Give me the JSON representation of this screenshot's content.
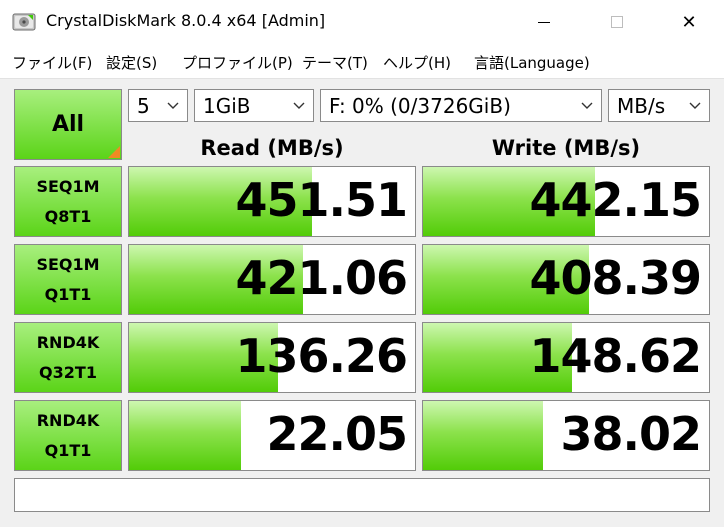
{
  "window": {
    "title": "CrystalDiskMark 8.0.4 x64 [Admin]",
    "close_glyph": "✕"
  },
  "menu": {
    "items": [
      "ファイル(F)",
      "設定(S)",
      "プロファイル(P)",
      "テーマ(T)",
      "ヘルプ(H)",
      "言語(Language)"
    ]
  },
  "controls": {
    "all_label": "All",
    "count_value": "5",
    "size_value": "1GiB",
    "drive_value": "F: 0% (0/3726GiB)",
    "unit_value": "MB/s"
  },
  "headers": {
    "read": "Read (MB/s)",
    "write": "Write (MB/s)"
  },
  "tests": [
    {
      "line1": "SEQ1M",
      "line2": "Q8T1",
      "read": "451.51",
      "write": "442.15",
      "read_level": 0.64,
      "write_level": 0.6
    },
    {
      "line1": "SEQ1M",
      "line2": "Q1T1",
      "read": "421.06",
      "write": "408.39",
      "read_level": 0.61,
      "write_level": 0.58
    },
    {
      "line1": "RND4K",
      "line2": "Q32T1",
      "read": "136.26",
      "write": "148.62",
      "read_level": 0.52,
      "write_level": 0.52
    },
    {
      "line1": "RND4K",
      "line2": "Q1T1",
      "read": "22.05",
      "write": "38.02",
      "read_level": 0.39,
      "write_level": 0.42
    }
  ],
  "colors": {
    "accent_green": "#5bd418",
    "corner_orange": "#f08a24"
  }
}
